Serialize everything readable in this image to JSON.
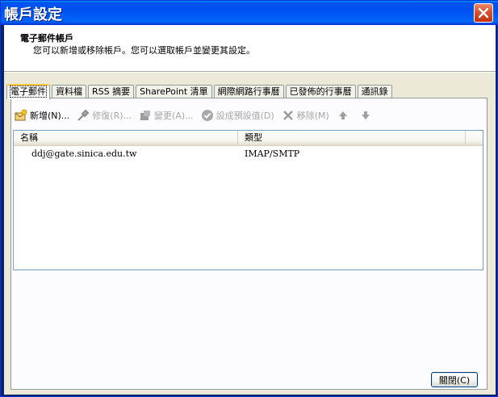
{
  "window": {
    "title": "帳戶設定",
    "close_icon": "close-icon"
  },
  "header": {
    "title": "電子郵件帳戶",
    "description": "您可以新增或移除帳戶。您可以選取帳戶並變更其設定。"
  },
  "tabs": [
    {
      "label": "電子郵件",
      "active": true
    },
    {
      "label": "資料檔",
      "active": false
    },
    {
      "label": "RSS 摘要",
      "active": false
    },
    {
      "label": "SharePoint 清單",
      "active": false
    },
    {
      "label": "網際網路行事曆",
      "active": false
    },
    {
      "label": "已發佈的行事曆",
      "active": false
    },
    {
      "label": "通訊錄",
      "active": false
    }
  ],
  "toolbar": {
    "new": {
      "label": "新增(N)...",
      "icon": "new-account-icon",
      "enabled": true
    },
    "repair": {
      "label": "修復(R)...",
      "icon": "repair-tools-icon",
      "enabled": false
    },
    "change": {
      "label": "變更(A)...",
      "icon": "change-icon",
      "enabled": false
    },
    "set_default": {
      "label": "設成預設值(D)",
      "icon": "checkmark-circle-icon",
      "enabled": false
    },
    "remove": {
      "label": "移除(M)",
      "icon": "remove-x-icon",
      "enabled": false
    },
    "move_up_icon": "arrow-up-icon",
    "move_down_icon": "arrow-down-icon"
  },
  "list": {
    "columns": [
      "名稱",
      "類型"
    ],
    "rows": [
      {
        "name": "ddj@gate.sinica.edu.tw",
        "type": "IMAP/SMTP"
      }
    ]
  },
  "footer": {
    "close_label": "關閉(C)"
  },
  "colors": {
    "titlebar": "#0053ee",
    "dialog_bg": "#ece9d8",
    "active_tab_accent": "#ffc83c",
    "close_button": "#d8502e"
  }
}
